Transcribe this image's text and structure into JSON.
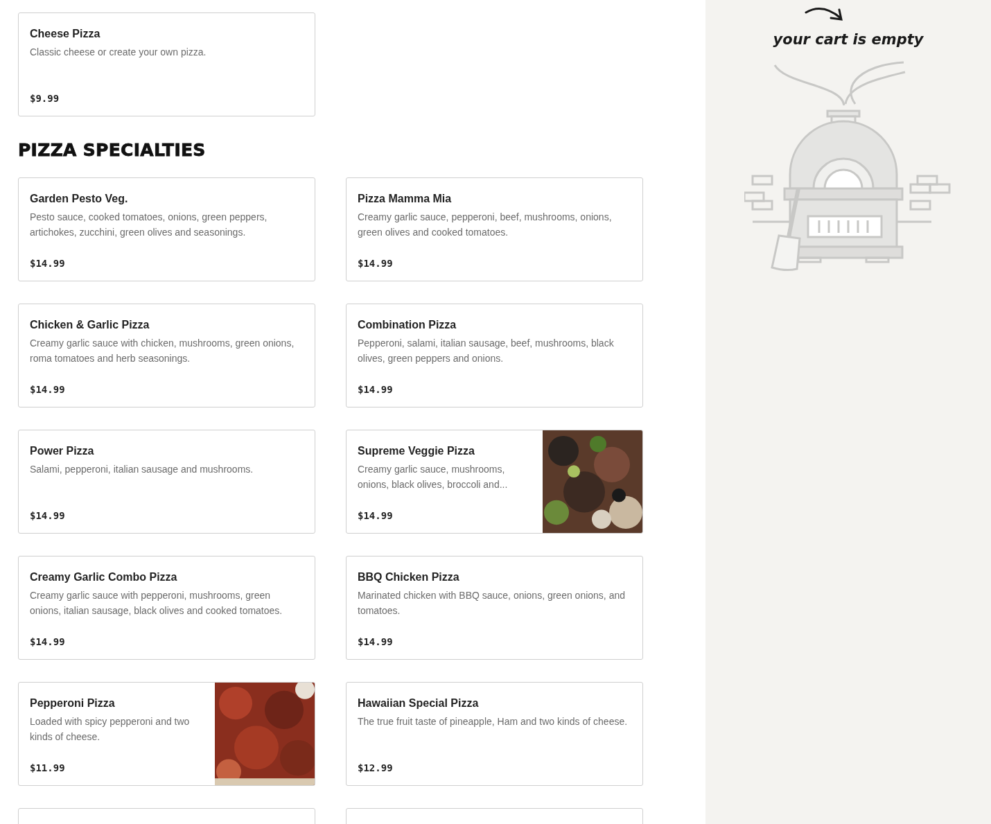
{
  "top_items": [
    {
      "kind": "item",
      "name": "Cheese Pizza",
      "description": "Classic cheese or create your own pizza.",
      "price": "$9.99"
    }
  ],
  "section": {
    "title": "PIZZA SPECIALTIES",
    "items": [
      {
        "kind": "item",
        "name": "Garden Pesto Veg.",
        "description": "Pesto sauce, cooked tomatoes, onions, green peppers, artichokes, zucchini, green olives and seasonings.",
        "price": "$14.99"
      },
      {
        "kind": "item",
        "name": "Pizza Mamma Mia",
        "description": "Creamy garlic sauce, pepperoni, beef, mushrooms, onions, green olives and cooked tomatoes.",
        "price": "$14.99"
      },
      {
        "kind": "item",
        "name": "Chicken & Garlic Pizza",
        "description": "Creamy garlic sauce with chicken, mushrooms, green onions, roma tomatoes and herb seasonings.",
        "price": "$14.99"
      },
      {
        "kind": "item",
        "name": "Combination Pizza",
        "description": "Pepperoni, salami, italian sausage, beef, mushrooms, black olives, green peppers and onions.",
        "price": "$14.99"
      },
      {
        "kind": "item",
        "name": "Power Pizza",
        "description": "Salami, pepperoni, italian sausage and mushrooms.",
        "price": "$14.99"
      },
      {
        "kind": "item",
        "name": "Supreme Veggie Pizza",
        "description": "Creamy garlic sauce, mushrooms, onions, black olives, broccoli and...",
        "price": "$14.99"
      },
      {
        "kind": "item",
        "name": "Creamy Garlic Combo Pizza",
        "description": "Creamy garlic sauce with pepperoni, mushrooms, green onions, italian sausage, black olives and cooked tomatoes.",
        "price": "$14.99"
      },
      {
        "kind": "item",
        "name": "BBQ Chicken Pizza",
        "description": "Marinated chicken with BBQ sauce, onions, green onions, and tomatoes.",
        "price": "$14.99"
      },
      {
        "kind": "item",
        "name": "Pepperoni Pizza",
        "description": "Loaded with spicy pepperoni and two kinds of cheese.",
        "price": "$11.99"
      },
      {
        "kind": "item",
        "name": "Hawaiian Special Pizza",
        "description": "The true fruit taste of pineapple, Ham and two kinds of cheese.",
        "price": "$12.99"
      },
      {
        "kind": "cut"
      },
      {
        "kind": "cut"
      }
    ]
  },
  "cart": {
    "message": "your cart is empty"
  }
}
